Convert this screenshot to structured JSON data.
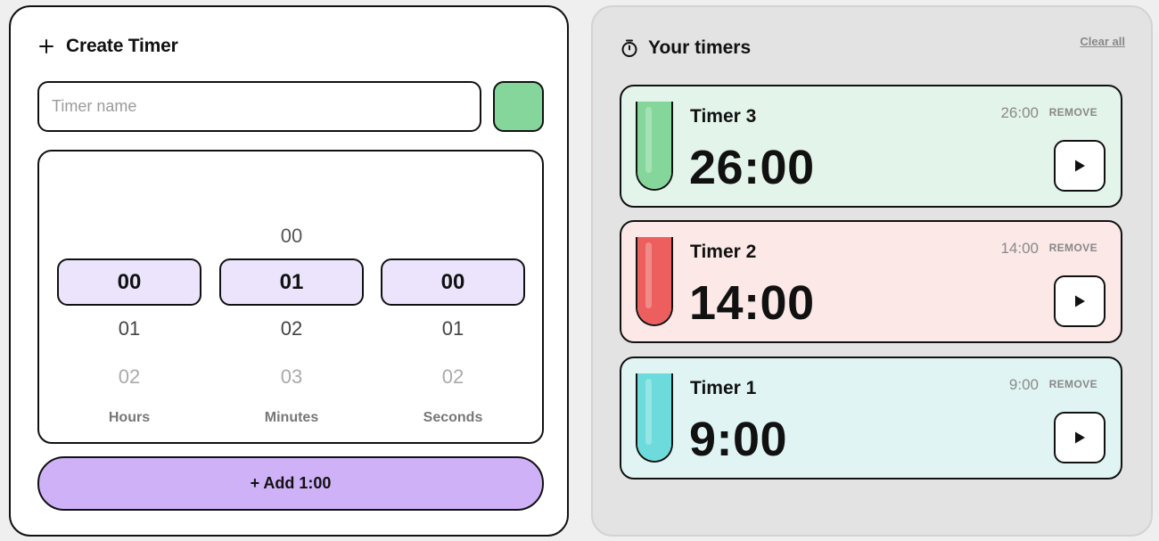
{
  "create": {
    "title": "Create Timer",
    "name_placeholder": "Timer name",
    "name_value": "",
    "color": "#84d69a",
    "picker": {
      "hours": {
        "prev": "",
        "selected": "00",
        "next1": "01",
        "next2": "02",
        "label": "Hours"
      },
      "minutes": {
        "prev": "00",
        "selected": "01",
        "next1": "02",
        "next2": "03",
        "label": "Minutes"
      },
      "seconds": {
        "prev": "",
        "selected": "00",
        "next1": "01",
        "next2": "02",
        "label": "Seconds"
      }
    },
    "add_button_label": "+ Add 1:00"
  },
  "timers_panel": {
    "title": "Your timers",
    "clear_all": "Clear all",
    "timers": [
      {
        "name": "Timer 3",
        "time": "26:00",
        "preset": "26:00",
        "remove": "REMOVE",
        "bg": "#e3f4ea",
        "fill": "#84d69a",
        "fill_fraction": 1.0
      },
      {
        "name": "Timer 2",
        "time": "14:00",
        "preset": "14:00",
        "remove": "REMOVE",
        "bg": "#fbe8e7",
        "fill": "#ec5f5e",
        "fill_fraction": 1.0
      },
      {
        "name": "Timer 1",
        "time": "9:00",
        "preset": "9:00",
        "remove": "REMOVE",
        "bg": "#e0f5f3",
        "fill": "#6ddbdb",
        "fill_fraction": 1.0
      }
    ]
  }
}
